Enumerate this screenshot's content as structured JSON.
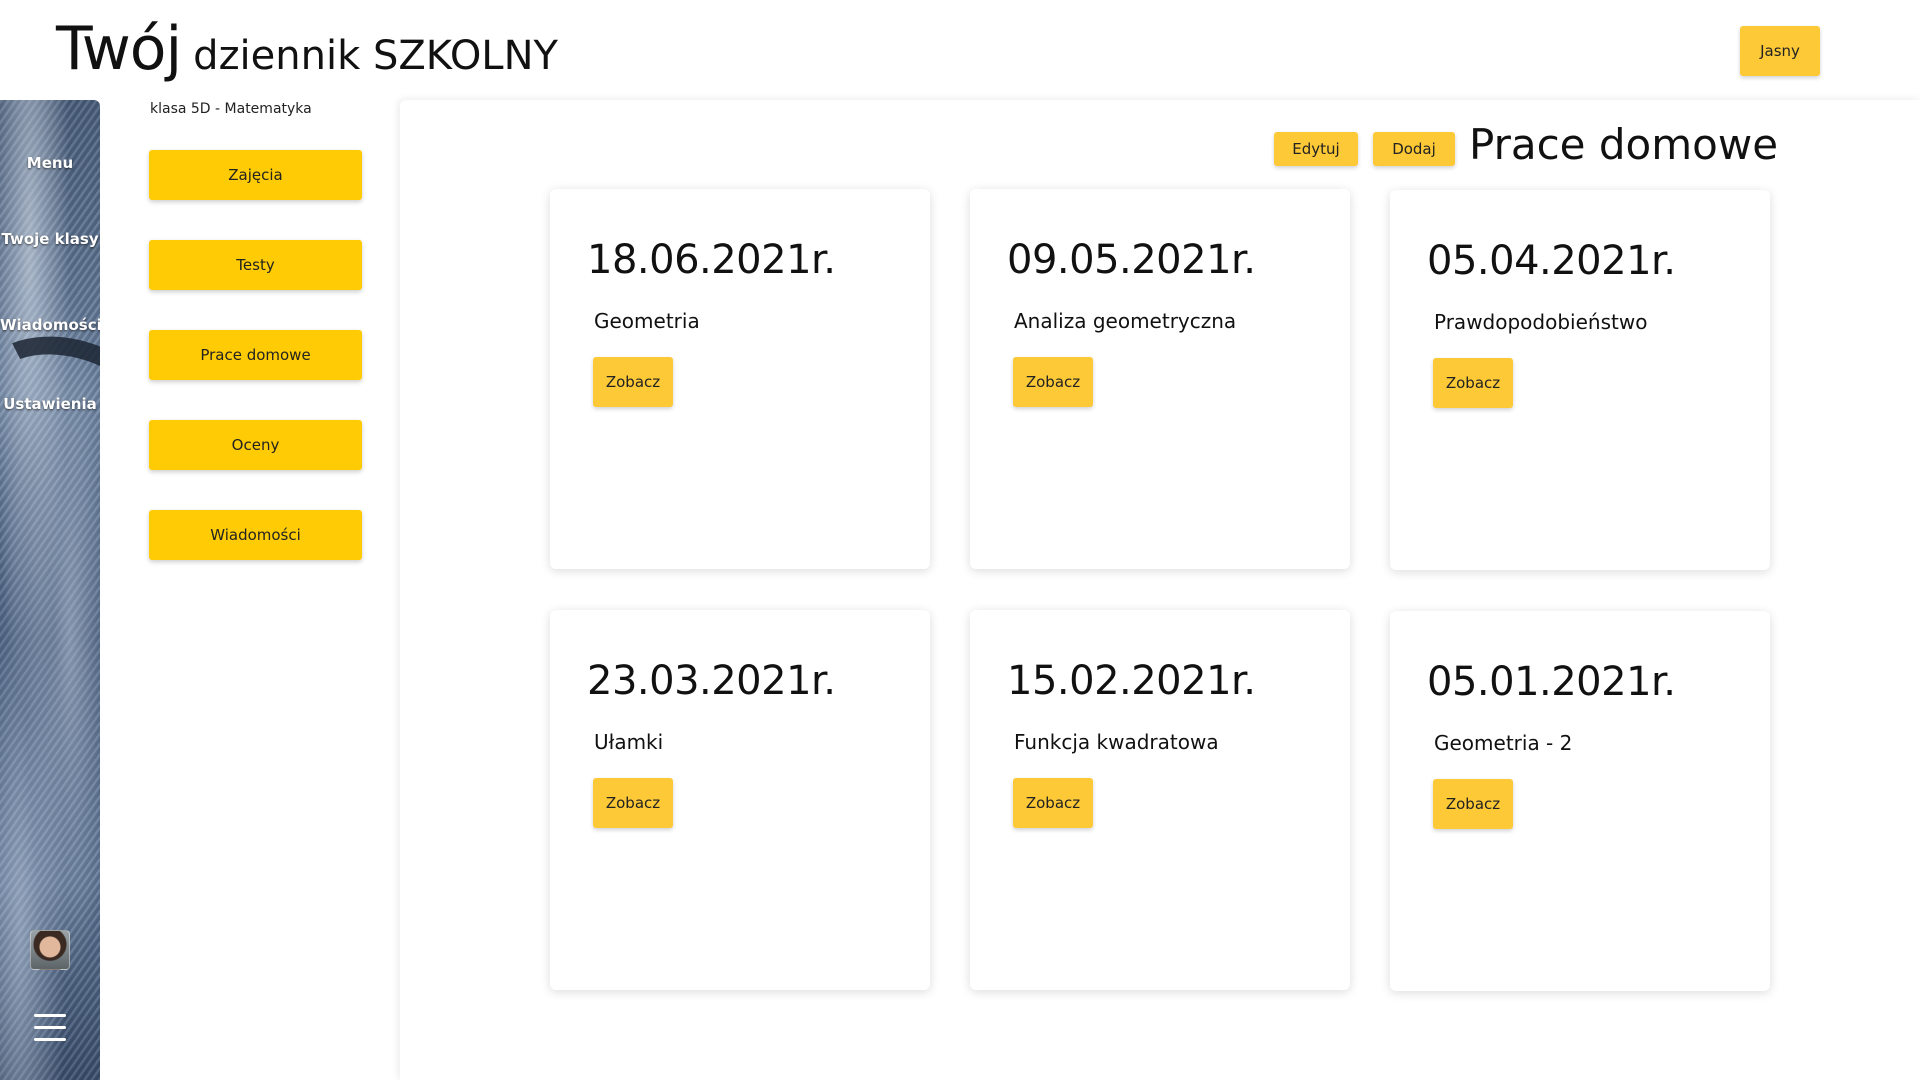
{
  "header": {
    "brand_big": "Twój",
    "brand_small": "dziennik SZKOLNY",
    "theme_label": "Jasny"
  },
  "rail": {
    "items": [
      {
        "label": "Menu"
      },
      {
        "label": "Twoje klasy"
      },
      {
        "label": "Wiadomości"
      },
      {
        "label": "Ustawienia"
      }
    ]
  },
  "submenu": {
    "context": "klasa 5D - Matematyka",
    "items": [
      {
        "label": "Zajęcia"
      },
      {
        "label": "Testy"
      },
      {
        "label": "Prace domowe"
      },
      {
        "label": "Oceny"
      },
      {
        "label": "Wiadomości"
      }
    ]
  },
  "main": {
    "title": "Prace domowe",
    "edit_label": "Edytuj",
    "add_label": "Dodaj",
    "cards": [
      {
        "date": "18.06.2021r.",
        "topic": "Geometria",
        "button": "Zobacz"
      },
      {
        "date": "09.05.2021r.",
        "topic": "Analiza geometryczna",
        "button": "Zobacz"
      },
      {
        "date": "05.04.2021r.",
        "topic": "Prawdopodobieństwo",
        "button": "Zobacz"
      },
      {
        "date": "23.03.2021r.",
        "topic": "Ułamki",
        "button": "Zobacz"
      },
      {
        "date": "15.02.2021r.",
        "topic": "Funkcja kwadratowa",
        "button": "Zobacz"
      },
      {
        "date": "05.01.2021r.",
        "topic": "Geometria - 2",
        "button": "Zobacz"
      }
    ]
  },
  "colors": {
    "accent": "#fdc936",
    "submenu_button": "#fecb04"
  }
}
